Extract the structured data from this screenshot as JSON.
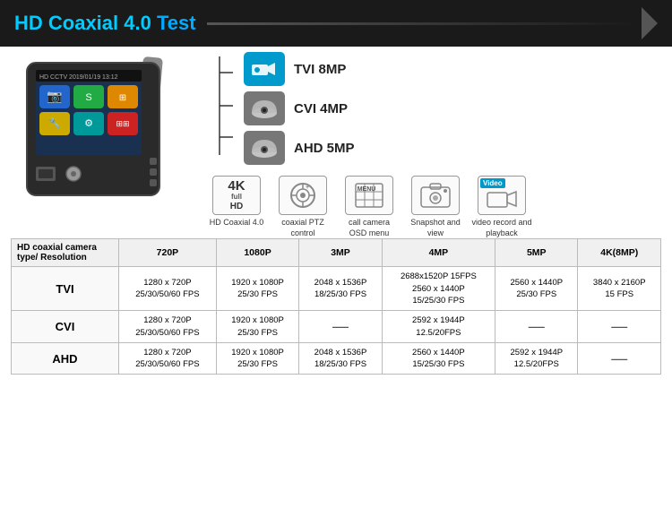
{
  "header": {
    "title_plain": "HD Coaxial 4.0 Test",
    "title_colored": "HD Coaxial 4.0",
    "title_suffix": " Test"
  },
  "camera_types": [
    {
      "name": "TVI 8MP",
      "type": "bullet"
    },
    {
      "name": "CVI 4MP",
      "type": "dome"
    },
    {
      "name": "AHD 5MP",
      "type": "dome"
    }
  ],
  "features": [
    {
      "label": "HD Coaxial 4.0",
      "icon_type": "4k"
    },
    {
      "label": "coaxial PTZ control",
      "icon_type": "ptz"
    },
    {
      "label": "call camera OSD menu",
      "icon_type": "menu"
    },
    {
      "label": "Snapshot and view",
      "icon_type": "snapshot"
    },
    {
      "label": "video record and playback",
      "icon_type": "video"
    }
  ],
  "table": {
    "col_headers": [
      "HD coaxial camera type/ Resolution",
      "720P",
      "1080P",
      "3MP",
      "4MP",
      "5MP",
      "4K(8MP)"
    ],
    "rows": [
      {
        "type": "TVI",
        "cells": [
          "1280 x 720P\n25/30/50/60 FPS",
          "1920 x 1080P\n25/30 FPS",
          "2048 x 1536P\n18/25/30 FPS",
          "2688x1520P 15FPS\n2560 x 1440P\n15/25/30 FPS",
          "2560 x 1440P\n25/30 FPS",
          "3840 x 2160P\n15 FPS"
        ]
      },
      {
        "type": "CVI",
        "cells": [
          "1280 x 720P\n25/30/50/60 FPS",
          "1920 x 1080P\n25/30 FPS",
          "—",
          "2592 x 1944P\n12.5/20FPS",
          "—",
          "—"
        ]
      },
      {
        "type": "AHD",
        "cells": [
          "1280 x 720P\n25/30/50/60 FPS",
          "1920 x 1080P\n25/30 FPS",
          "2048 x 1536P\n18/25/30 FPS",
          "2560 x 1440P\n15/25/30 FPS",
          "2592 x 1944P\n12.5/20FPS",
          "—"
        ]
      }
    ]
  },
  "screen": {
    "top_text": "HD CCTV  2019/01/19 13:12"
  }
}
